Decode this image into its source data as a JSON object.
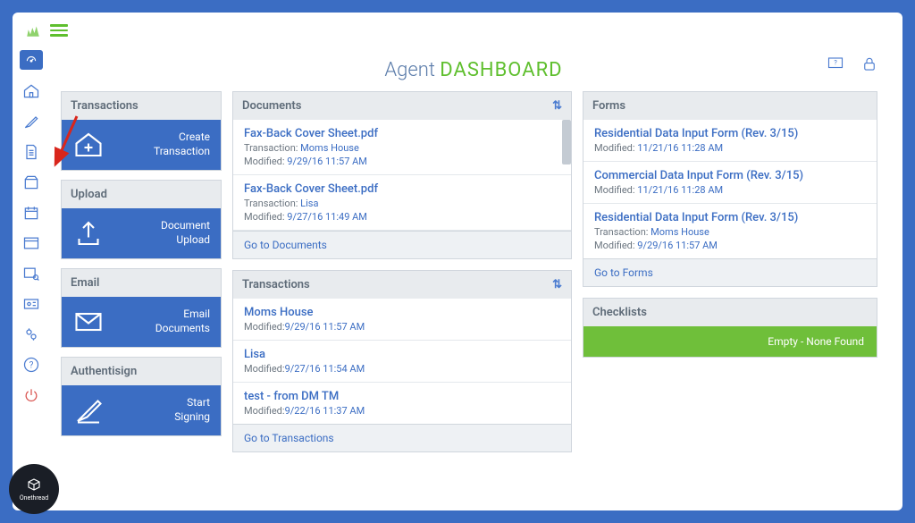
{
  "page_title": {
    "part1": "Agent ",
    "part2": "DASHBOARD"
  },
  "sidebar_tiles": {
    "transactions": {
      "header": "Transactions",
      "action": "Create\nTransaction"
    },
    "upload": {
      "header": "Upload",
      "action": "Document\nUpload"
    },
    "email": {
      "header": "Email",
      "action": "Email\nDocuments"
    },
    "authentisign": {
      "header": "Authentisign",
      "action": "Start\nSigning"
    }
  },
  "documents": {
    "header": "Documents",
    "items": [
      {
        "title": "Fax-Back Cover Sheet.pdf",
        "tx_label": "Transaction:",
        "tx": "Moms House",
        "mod_label": "Modified:",
        "mod": "9/29/16 11:57 AM"
      },
      {
        "title": "Fax-Back Cover Sheet.pdf",
        "tx_label": "Transaction:",
        "tx": "Lisa",
        "mod_label": "Modified:",
        "mod": "9/27/16 11:49 AM"
      }
    ],
    "go": "Go to Documents"
  },
  "transactions_panel": {
    "header": "Transactions",
    "items": [
      {
        "title": "Moms House",
        "mod_label": "Modified:",
        "mod": "9/29/16 11:57 AM"
      },
      {
        "title": "Lisa",
        "mod_label": "Modified:",
        "mod": "9/27/16 11:54 AM"
      },
      {
        "title": "test - from DM TM",
        "mod_label": "Modified:",
        "mod": "9/22/16 11:37 AM"
      }
    ],
    "go": "Go to Transactions"
  },
  "forms": {
    "header": "Forms",
    "items": [
      {
        "title": "Residential Data Input Form (Rev. 3/15)",
        "mod_label": "Modified:",
        "mod": "11/21/16 11:28 AM"
      },
      {
        "title": "Commercial Data Input Form (Rev. 3/15)",
        "mod_label": "Modified:",
        "mod": "11/21/16 11:28 AM"
      },
      {
        "title": "Residential Data Input Form (Rev. 3/15)",
        "tx_label": "Transaction:",
        "tx": "Moms House",
        "mod_label": "Modified:",
        "mod": "9/29/16 11:57 AM"
      }
    ],
    "go": "Go to Forms"
  },
  "checklists": {
    "header": "Checklists",
    "empty": "Empty - None Found"
  },
  "badge_label": "Onethread"
}
